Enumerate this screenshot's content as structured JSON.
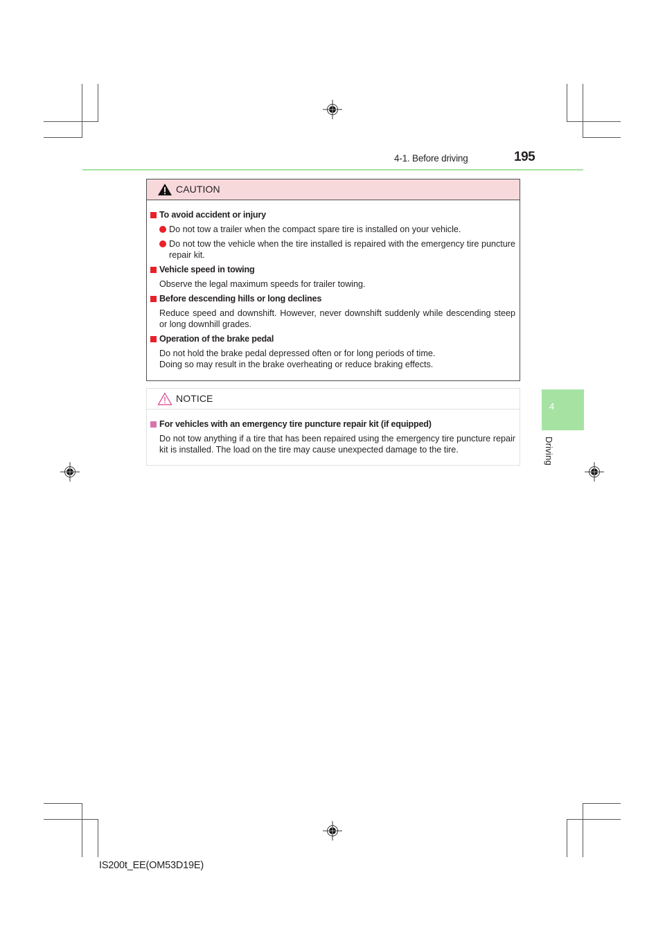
{
  "header": {
    "section_title": "4-1. Before driving",
    "page_number": "195"
  },
  "chapter_tab": {
    "number": "4",
    "label": "Driving",
    "color": "#a6e3a3"
  },
  "caution": {
    "title": "CAUTION",
    "icon": "warning-triangle-icon",
    "sections": [
      {
        "heading": "To avoid accident or injury",
        "bullets": [
          "Do not tow a trailer when the compact spare tire is installed on your vehicle.",
          "Do not tow the vehicle when the tire installed is repaired with the emergency tire puncture repair kit."
        ]
      },
      {
        "heading": "Vehicle speed in towing",
        "lines": [
          "Observe the legal maximum speeds for trailer towing."
        ]
      },
      {
        "heading": "Before descending hills or long declines",
        "lines": [
          "Reduce speed and downshift. However, never downshift suddenly while descending steep or long downhill grades."
        ]
      },
      {
        "heading": "Operation of the brake pedal",
        "lines": [
          "Do not hold the brake pedal depressed often or for long periods of time.",
          "Doing so may result in the brake overheating or reduce braking effects."
        ]
      }
    ]
  },
  "notice": {
    "title": "NOTICE",
    "icon": "notice-triangle-icon",
    "sections": [
      {
        "heading": "For vehicles with an emergency tire puncture repair kit (if equipped)",
        "lines": [
          "Do not tow anything if a tire that has been repaired using the emergency tire puncture repair kit is installed. The load on the tire may cause unexpected damage to the tire."
        ]
      }
    ]
  },
  "footer": {
    "code": "IS200t_EE(OM53D19E)"
  },
  "colors": {
    "caution_header_bg": "#f7d9dc",
    "caution_accent": "#e8202a",
    "notice_accent": "#d873ad",
    "rule_green": "#a6e3a3"
  }
}
